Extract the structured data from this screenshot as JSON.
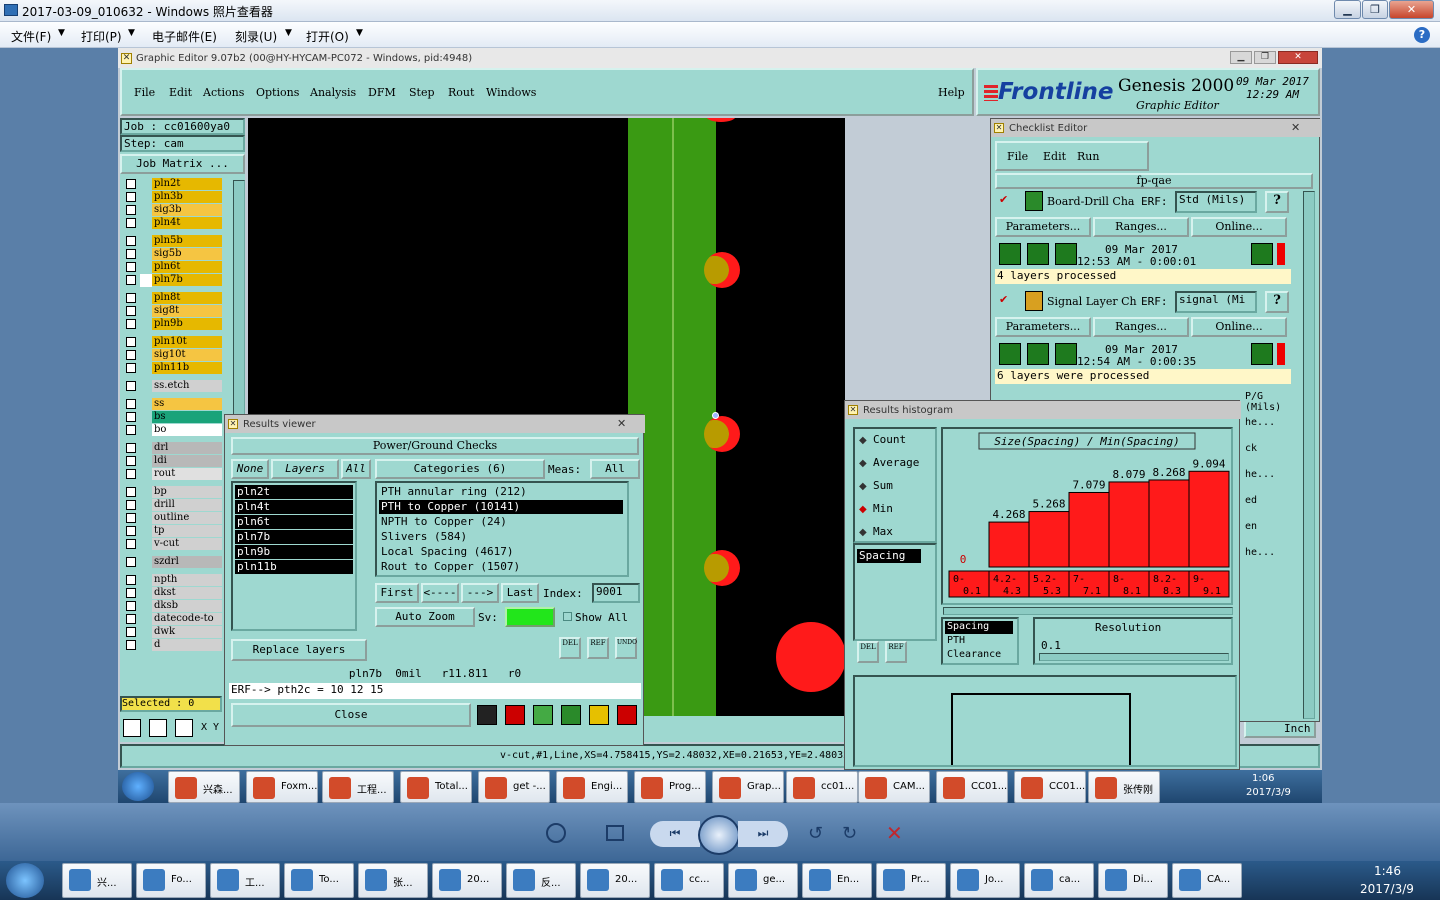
{
  "viewer": {
    "title": "2017-03-09_010632 - Windows 照片查看器",
    "menu": [
      "文件(F)",
      "打印(P)",
      "电子邮件(E)",
      "刻录(U)",
      "打开(O)"
    ],
    "help_icon": "help-icon"
  },
  "genesis": {
    "title": "Graphic Editor 9.07b2 (00@HY-HYCAM-PC072 - Windows, pid:4948)",
    "menu": [
      "File",
      "Edit",
      "Actions",
      "Options",
      "Analysis",
      "DFM",
      "Step",
      "Rout",
      "Windows"
    ],
    "help": "Help",
    "brand": "Frontline",
    "product": "Genesis 2000",
    "subtitle": "Graphic Editor",
    "date": "09 Mar 2017",
    "time": "12:29 AM",
    "job": "Job : cc01600ya0",
    "step": "Step: cam",
    "job_matrix": "Job Matrix ...",
    "selected": "Selected : 0",
    "units": "Inch",
    "coords": "v-cut,#1,Line,XS=4.758415,YS=2.48032,XE=0.21653,YE=2.48032,"
  },
  "layers": [
    {
      "name": "pln2t",
      "color": "#e6b800"
    },
    {
      "name": "pln3b",
      "color": "#e6b800"
    },
    {
      "name": "sig3b",
      "color": "#f5c542"
    },
    {
      "name": "pln4t",
      "color": "#e6b800"
    },
    {
      "name": "pln5b",
      "color": "#e6b800"
    },
    {
      "name": "sig5b",
      "color": "#f5c542"
    },
    {
      "name": "pln6t",
      "color": "#e6b800"
    },
    {
      "name": "pln7b",
      "color": "#e6b800"
    },
    {
      "name": "pln8t",
      "color": "#e6b800"
    },
    {
      "name": "sig8t",
      "color": "#f5c542"
    },
    {
      "name": "pln9b",
      "color": "#e6b800"
    },
    {
      "name": "pln10t",
      "color": "#e6b800"
    },
    {
      "name": "sig10t",
      "color": "#f5c542"
    },
    {
      "name": "pln11b",
      "color": "#e6b800"
    },
    {
      "name": "ss.etch",
      "color": "#d0d0d0"
    },
    {
      "name": "ss",
      "color": "#f5c542"
    },
    {
      "name": "bs",
      "color": "#1aa37a"
    },
    {
      "name": "bo",
      "color": "#ffffff"
    },
    {
      "name": "drl",
      "color": "#b8b8b8"
    },
    {
      "name": "ldi",
      "color": "#b8b8b8"
    },
    {
      "name": "rout",
      "color": "#e0e0e0"
    },
    {
      "name": "bp",
      "color": "#d0d0d0"
    },
    {
      "name": "drill",
      "color": "#d0d0d0"
    },
    {
      "name": "outline",
      "color": "#d0d0d0"
    },
    {
      "name": "tp",
      "color": "#d0d0d0"
    },
    {
      "name": "v-cut",
      "color": "#d0d0d0"
    },
    {
      "name": "szdrl",
      "color": "#b8b8b8"
    },
    {
      "name": "npth",
      "color": "#d0d0d0"
    },
    {
      "name": "dkst",
      "color": "#d0d0d0"
    },
    {
      "name": "dksb",
      "color": "#d0d0d0"
    },
    {
      "name": "datecode-to",
      "color": "#d0d0d0"
    },
    {
      "name": "dwk",
      "color": "#d0d0d0"
    },
    {
      "name": "d",
      "color": "#d0d0d0"
    }
  ],
  "results": {
    "title": "Results viewer",
    "header": "Power/Ground Checks",
    "none": "None",
    "layers_label": "Layers",
    "all": "All",
    "categories_label": "Categories (6)",
    "meas_label": "Meas:",
    "meas_value": "All",
    "layer_items": [
      "pln2t",
      "pln4t",
      "pln6t",
      "pln7b",
      "pln9b",
      "pln11b"
    ],
    "categories": [
      "PTH annular ring (212)",
      "PTH to Copper (10141)",
      "NPTH to Copper (24)",
      "Slivers (584)",
      "Local Spacing (4617)",
      "Rout to Copper (1507)"
    ],
    "first": "First",
    "prev": "<----",
    "next": "--->",
    "last": "Last",
    "index_label": "Index:",
    "index_value": "9001",
    "auto_zoom": "Auto Zoom",
    "sv": "Sv:",
    "show_all": "Show All",
    "replace_layers": "Replace layers",
    "status": "pln7b  0mil   r11.811   r0",
    "erf": "ERF--> pth2c = 10 12 15",
    "close": "Close",
    "del": "DEL",
    "ref": "REF",
    "undo": "UNDO"
  },
  "checklist": {
    "title": "Checklist Editor",
    "menu": [
      "File",
      "Edit",
      "Run"
    ],
    "name": "fp-qae",
    "erf_label": "ERF:",
    "params": "Parameters...",
    "ranges": "Ranges...",
    "online": "Online...",
    "checks": [
      {
        "name": "Board-Drill Cha",
        "erf": "Std (Mils)",
        "date": "09 Mar 2017",
        "time": "12:53 AM - 0:00:01",
        "status": "4 layers processed"
      },
      {
        "name": "Signal Layer Ch",
        "erf": "signal (Mi",
        "date": "09 Mar 2017",
        "time": "12:54 AM - 0:00:35",
        "status": "6 layers were processed"
      }
    ],
    "partial": [
      "P/G (Mils)",
      "he...",
      "ck",
      "he...",
      "ed",
      "en",
      "he..."
    ]
  },
  "histogram": {
    "title": "Results histogram",
    "modes": [
      "Count",
      "Average",
      "Sum",
      "Min",
      "Max"
    ],
    "selected_mode": "Min",
    "list": [
      "Spacing"
    ],
    "chart_title": "Size(Spacing) / Min(Spacing)",
    "categories_list": [
      "Spacing",
      "PTH",
      "Clearance"
    ],
    "resolution_label": "Resolution",
    "resolution_value": "0.1",
    "del": "DEL",
    "ref": "REF"
  },
  "chart_data": {
    "type": "bar",
    "title": "Size(Spacing) / Min(Spacing)",
    "categories": [
      "0-0.1",
      "4.2-4.3",
      "5.2-5.3",
      "7-7.1",
      "8-8.1",
      "8.2-8.3",
      "9-9.1"
    ],
    "values": [
      0,
      4.268,
      5.268,
      7.079,
      8.079,
      8.268,
      9.094
    ],
    "value_labels": [
      "0",
      "4.268",
      "5.268",
      "7.079",
      "8.079",
      "8.268",
      "9.094"
    ],
    "ylim": [
      0,
      9.5
    ],
    "color": "#ff1a1a"
  },
  "inner_taskbar": {
    "items": [
      "兴森...",
      "Foxm...",
      "工程...",
      "Total...",
      "get -...",
      "Engi...",
      "Prog...",
      "Grap...",
      "cc01...",
      "CAM...",
      "CC01...",
      "CC01...",
      "张传刚"
    ],
    "time": "1:06",
    "date": "2017/3/9"
  },
  "outer_taskbar": {
    "items": [
      "兴...",
      "Fo...",
      "工...",
      "To...",
      "张...",
      "20...",
      "反...",
      "20...",
      "cc...",
      "ge...",
      "En...",
      "Pr...",
      "Jo...",
      "ca...",
      "Di...",
      "CA..."
    ],
    "time": "1:46",
    "date": "2017/3/9"
  }
}
